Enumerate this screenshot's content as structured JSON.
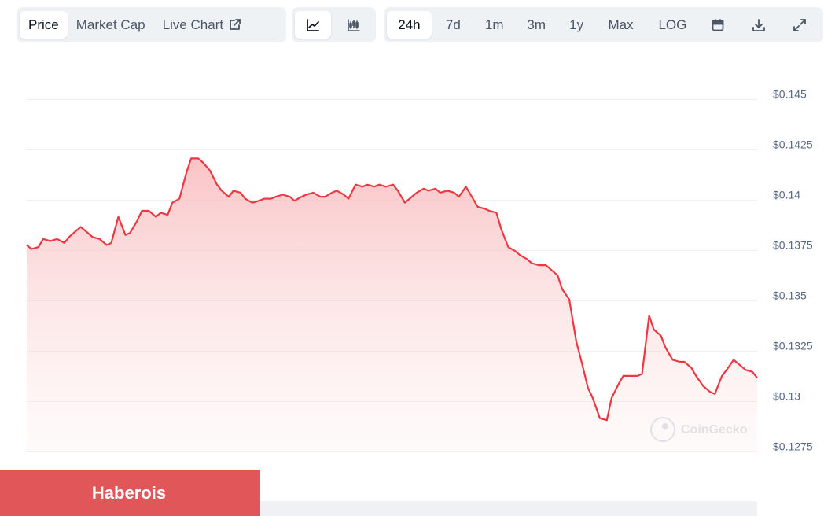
{
  "toolbar": {
    "metric_tabs": [
      {
        "label": "Price",
        "active": true
      },
      {
        "label": "Market Cap",
        "active": false
      },
      {
        "label": "Live Chart",
        "active": false
      }
    ],
    "chart_type_icons": [
      "line-chart-icon",
      "candlestick-chart-icon"
    ],
    "range_tabs": [
      {
        "label": "24h",
        "active": true
      },
      {
        "label": "7d",
        "active": false
      },
      {
        "label": "1m",
        "active": false
      },
      {
        "label": "3m",
        "active": false
      },
      {
        "label": "1y",
        "active": false
      },
      {
        "label": "Max",
        "active": false
      },
      {
        "label": "LOG",
        "active": false
      }
    ],
    "action_icons": [
      "calendar-icon",
      "download-icon",
      "expand-icon"
    ]
  },
  "watermark": "CoinGecko",
  "banner": {
    "label": "Haberois"
  },
  "colors": {
    "line": "#ea3943",
    "fill_top": "#f8b9bb",
    "banner": "#e15759",
    "grid": "#eceef2"
  },
  "chart_data": {
    "type": "area",
    "y_tick_labels": [
      "$0.145",
      "$0.1425",
      "$0.14",
      "$0.1375",
      "$0.135",
      "$0.1325",
      "$0.13",
      "$0.1275"
    ],
    "y_ticks": [
      0.145,
      0.1425,
      0.14,
      0.1375,
      0.135,
      0.1325,
      0.13,
      0.1275
    ],
    "ylim": [
      0.1275,
      0.145
    ],
    "xlim": [
      0,
      311
    ],
    "grid": true,
    "legend": "none",
    "x": [
      0,
      2,
      5,
      7,
      10,
      13,
      16,
      18,
      21,
      23,
      26,
      28,
      31,
      34,
      36,
      39,
      42,
      44,
      47,
      49,
      52,
      55,
      57,
      60,
      62,
      65,
      68,
      70,
      73,
      75,
      78,
      81,
      83,
      86,
      88,
      91,
      93,
      96,
      99,
      101,
      104,
      106,
      109,
      112,
      114,
      117,
      119,
      122,
      125,
      127,
      130,
      132,
      135,
      137,
      140,
      143,
      145,
      148,
      150,
      153,
      156,
      158,
      161,
      163,
      166,
      169,
      171,
      174,
      176,
      179,
      182,
      184,
      187,
      189,
      192,
      195,
      197,
      200,
      202,
      205,
      208,
      210,
      213,
      215,
      218,
      221,
      223,
      226,
      228,
      231,
      234,
      236,
      239,
      241,
      244,
      247,
      249,
      252,
      254,
      257,
      260,
      262,
      265,
      267,
      270,
      272,
      275,
      278,
      280,
      283,
      285,
      288,
      291,
      293,
      296,
      298,
      301,
      304,
      306,
      309,
      311
    ],
    "y": [
      0.1375,
      0.1373,
      0.1374,
      0.1378,
      0.1377,
      0.1378,
      0.1376,
      0.1379,
      0.1382,
      0.1384,
      0.1381,
      0.1379,
      0.1378,
      0.1375,
      0.1376,
      0.1389,
      0.138,
      0.1381,
      0.1387,
      0.1392,
      0.1392,
      0.1389,
      0.1391,
      0.139,
      0.1396,
      0.1398,
      0.1411,
      0.1418,
      0.1418,
      0.1416,
      0.1412,
      0.1405,
      0.1402,
      0.1399,
      0.1402,
      0.1401,
      0.1398,
      0.1396,
      0.1397,
      0.1398,
      0.1398,
      0.1399,
      0.14,
      0.1399,
      0.1397,
      0.1399,
      0.14,
      0.1401,
      0.1399,
      0.1399,
      0.1401,
      0.1402,
      0.14,
      0.1398,
      0.1405,
      0.1404,
      0.1405,
      0.1404,
      0.1405,
      0.1404,
      0.1405,
      0.1402,
      0.1396,
      0.1398,
      0.1401,
      0.1403,
      0.1402,
      0.1403,
      0.1401,
      0.1402,
      0.1401,
      0.1399,
      0.1404,
      0.14,
      0.1394,
      0.1393,
      0.1392,
      0.1391,
      0.1383,
      0.1374,
      0.1372,
      0.137,
      0.1368,
      0.1366,
      0.1365,
      0.1365,
      0.1363,
      0.136,
      0.1353,
      0.1348,
      0.1327,
      0.1318,
      0.1304,
      0.1299,
      0.1289,
      0.1288,
      0.1299,
      0.1306,
      0.131,
      0.131,
      0.131,
      0.1311,
      0.134,
      0.1333,
      0.133,
      0.1324,
      0.1318,
      0.1317,
      0.1317,
      0.1314,
      0.131,
      0.1305,
      0.1302,
      0.1301,
      0.131,
      0.1313,
      0.1318,
      0.1315,
      0.1313,
      0.1312,
      0.1309
    ]
  }
}
